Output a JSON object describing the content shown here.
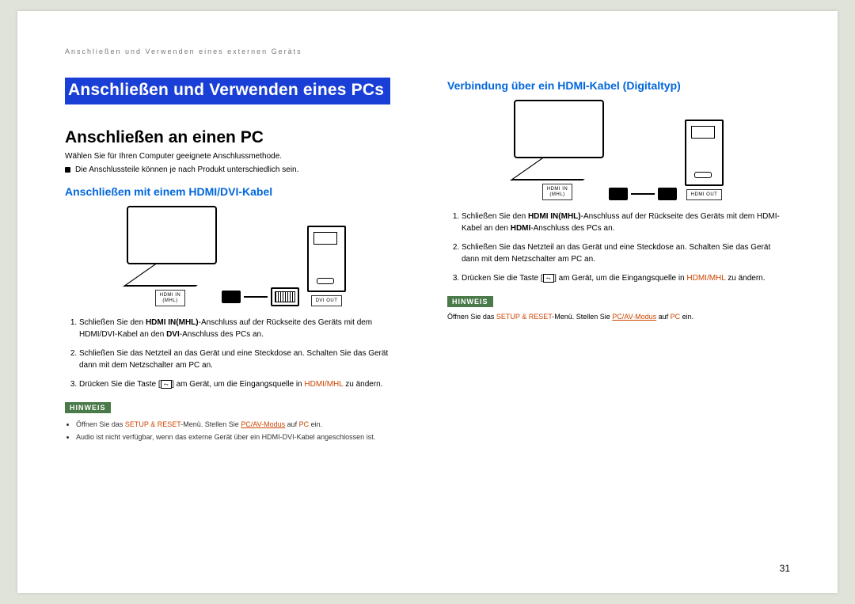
{
  "header": {
    "breadcrumb": "Anschließen und Verwenden eines externen Geräts"
  },
  "left": {
    "mainTitle": "Anschließen und Verwenden eines PCs",
    "subTitle": "Anschließen an einen PC",
    "intro": "Wählen Sie für Ihren Computer geeignete Anschlussmethode.",
    "note1": "Die Anschlussteile können je nach Produkt unterschiedlich sein.",
    "sectionTitle": "Anschließen mit einem HDMI/DVI-Kabel",
    "port_monitor": "HDMI IN\n(MHL)",
    "port_pc": "DVI OUT",
    "step1_a": "Schließen Sie den ",
    "step1_b": "HDMI IN(MHL)",
    "step1_c": "-Anschluss auf der Rückseite des Geräts mit dem HDMI/DVI-Kabel an den ",
    "step1_d": "DVI",
    "step1_e": "-Anschluss des PCs an.",
    "step2": "Schließen Sie das Netzteil an das Gerät und eine Steckdose an. Schalten Sie das Gerät dann mit dem Netzschalter am PC an.",
    "step3_a": "Drücken Sie die Taste [",
    "step3_b": "] am Gerät, um die Eingangsquelle in ",
    "step3_src": "HDMI/MHL",
    "step3_c": " zu ändern.",
    "hinweisTag": "HINWEIS",
    "hinweis1_a": "Öffnen Sie das ",
    "hinweis1_b": "SETUP & RESET",
    "hinweis1_c": "-Menü. Stellen Sie ",
    "hinweis1_d": "PC/AV-Modus",
    "hinweis1_e": " auf ",
    "hinweis1_f": "PC",
    "hinweis1_g": " ein.",
    "hinweis2": "Audio ist nicht verfügbar, wenn das externe Gerät über ein HDMI-DVI-Kabel angeschlossen ist."
  },
  "right": {
    "sectionTitle": "Verbindung über ein HDMI-Kabel (Digitaltyp)",
    "port_monitor": "HDMI IN\n(MHL)",
    "port_pc": "HDMI OUT",
    "step1_a": "Schließen Sie den ",
    "step1_b": "HDMI IN(MHL)",
    "step1_c": "-Anschluss auf der Rückseite des Geräts mit dem HDMI-Kabel an den ",
    "step1_d": "HDMI",
    "step1_e": "-Anschluss des PCs an.",
    "step2": "Schließen Sie das Netzteil an das Gerät und eine Steckdose an. Schalten Sie das Gerät dann mit dem Netzschalter am PC an.",
    "step3_a": "Drücken Sie die Taste [",
    "step3_b": "] am Gerät, um die Eingangsquelle in ",
    "step3_src": "HDMI/MHL",
    "step3_c": " zu ändern.",
    "hinweisTag": "HINWEIS",
    "hinweis1_a": "Öffnen Sie das ",
    "hinweis1_b": "SETUP & RESET",
    "hinweis1_c": "-Menü. Stellen Sie ",
    "hinweis1_d": "PC/AV-Modus",
    "hinweis1_e": " auf ",
    "hinweis1_f": "PC",
    "hinweis1_g": " ein."
  },
  "pageNumber": "31",
  "icons": {
    "source": "⥊"
  }
}
